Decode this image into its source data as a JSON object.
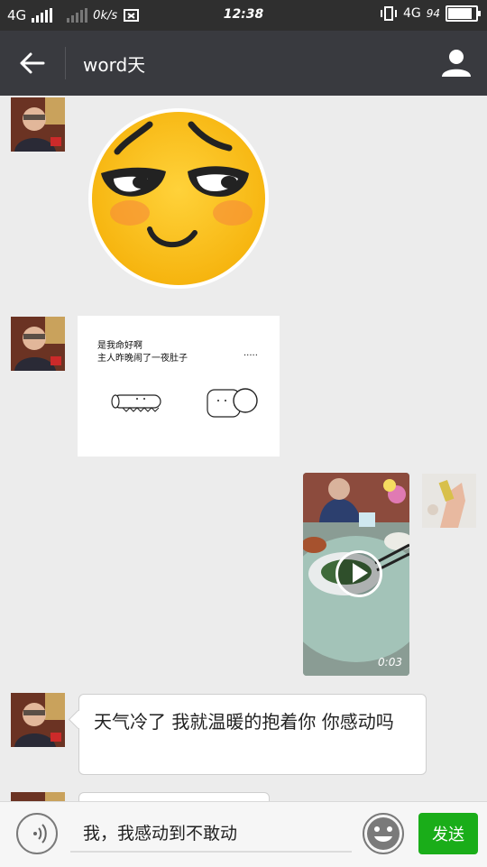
{
  "status_bar": {
    "network_left": "4G",
    "speed": "0k/s",
    "time": "12:38",
    "network_right": "4G",
    "battery": "94",
    "battery_level": 0.94
  },
  "header": {
    "title": "word天",
    "back_icon": "arrow-left-icon",
    "profile_icon": "person-icon"
  },
  "messages": [
    {
      "type": "sticker",
      "side": "left",
      "content": "smug-emoji-sticker"
    },
    {
      "type": "sticker",
      "side": "left",
      "line1": "是我命好啊",
      "line2": "主人昨晚闹了一夜肚子",
      "ellipsis": "....."
    },
    {
      "type": "video",
      "side": "right",
      "duration": "0:03"
    },
    {
      "type": "text",
      "side": "left",
      "text": "天气冷了 我就温暖的抱着你 你感动吗"
    },
    {
      "type": "text",
      "side": "left",
      "text": ""
    }
  ],
  "input": {
    "value": "我，我感动到不敢动",
    "send_label": "发送",
    "voice_icon": "voice-icon",
    "emoji_icon": "smiley-icon"
  },
  "colors": {
    "status_bar": "#2f2f2f",
    "header": "#393a3f",
    "background": "#ececec",
    "send_button": "#1aad19"
  }
}
